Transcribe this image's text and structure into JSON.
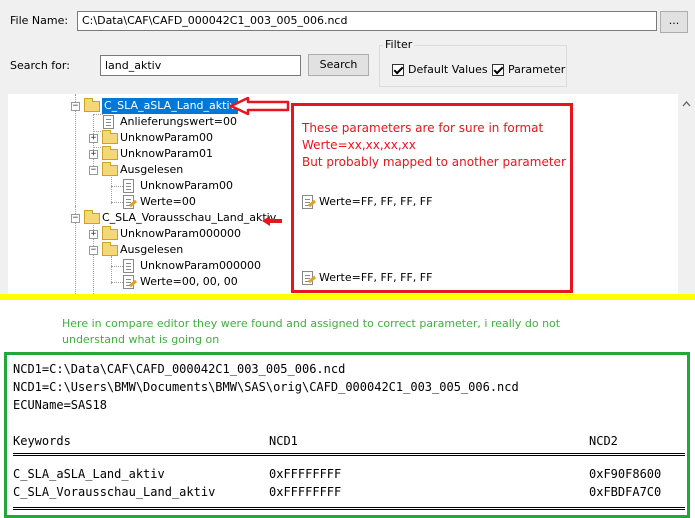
{
  "form": {
    "file_label": "File Name:",
    "file_value": "C:\\Data\\CAF\\CAFD_000042C1_003_005_006.ncd",
    "browse_label": "...",
    "search_label": "Search for:",
    "search_value": "land_aktiv",
    "search_button": "Search",
    "filter_title": "Filter",
    "default_values_label": "Default Values",
    "default_values_checked": true,
    "parameter_label": "Parameter",
    "parameter_checked": true
  },
  "tree": {
    "n1": "C_SLA_aSLA_Land_aktiv",
    "n2": "Anlieferungswert=00",
    "n3": "UnknowParam00",
    "n4": "UnknowParam01",
    "n5": "Ausgelesen",
    "n6": "UnknowParam00",
    "n7": "Werte=00",
    "n8": "C_SLA_Vorausschau_Land_aktiv",
    "n9": "UnknowParam000000",
    "n10": "Ausgelesen",
    "n11": "UnknowParam000000",
    "n12": "Werte=00, 00, 00"
  },
  "annotation": {
    "line1": "These parameters are for sure in format",
    "line2": "Werte=xx,xx,xx,xx",
    "line3": "But probably mapped to another parameter",
    "value1": "Werte=FF, FF, FF, FF",
    "value2": "Werte=FF, FF, FF, FF"
  },
  "compare": {
    "note": "Here in compare editor they were found and assigned to correct parameter, i really do not understand what is going on",
    "ncd1_line1": "NCD1=C:\\Data\\CAF\\CAFD_000042C1_003_005_006.ncd",
    "ncd1_line2": "NCD1=C:\\Users\\BMW\\Documents\\BMW\\SAS\\orig\\CAFD_000042C1_003_005_006.ncd",
    "ecu_line": "ECUName=SAS18",
    "headers": {
      "keywords": "Keywords",
      "ncd1": "NCD1",
      "ncd2": "NCD2"
    },
    "rows": [
      {
        "keyword": "C_SLA_aSLA_Land_aktiv",
        "ncd1": "0xFFFFFFFF",
        "ncd2": "0xF90F8600"
      },
      {
        "keyword": "C_SLA_Vorausschau_Land_aktiv",
        "ncd1": "0xFFFFFFFF",
        "ncd2": "0xFBDFA7C0"
      }
    ]
  }
}
